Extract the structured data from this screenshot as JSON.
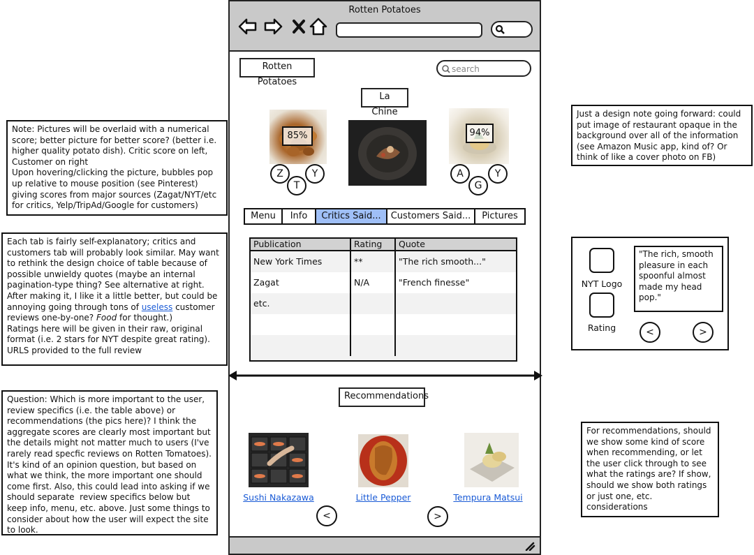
{
  "notes": {
    "left1": "Note: Pictures will be overlaid with a numerical score; better picture for better score? (better i.e. higher quality potato dish). Critic score on left, Customer on right\nUpon hovering/clicking the picture, bubbles pop up relative to mouse position (see Pinterest) giving scores from major sources (Zagat/NYT/etc for critics, Yelp/TripAd/Google for customers)",
    "left2_a": "Each tab is fairly self-explanatory; critics and customers tab will probably look similar. May want to rethink the design choice of table because of possible unwieldy quotes (maybe an internal pagination-type thing? See alternative at right. After making it, I like it a little better, but could be annoying going through tons of ",
    "left2_link": "useless",
    "left2_b": " customer reviews one-by-one? ",
    "left2_italic": "Food",
    "left2_c": " for thought.)\nRatings here will be given in their raw, original format (i.e. 2 stars for NYT despite great rating). URLS provided to the full review",
    "left3": "Question: Which is more important to the user, review specifics (i.e. the table above) or recommendations (the pics here)? I think the aggregate scores are clearly most important but the details might not matter much to users (I've rarely read specfic reviews on Rotten Tomatoes). It's kind of an opinion question, but based on what we think, the more important one should come first. Also, this could lead into asking if we should separate  review specifics below but keep info, menu, etc. above. Just some things to consider about how the user will expect the site to look.",
    "right1": "Just a design note going forward: could put image of restaurant opaque in the background over all of the information (see Amazon Music app, kind of? Or think of like a cover photo on FB)",
    "right2": "For recommendations, should we show some kind of score when recommending, or let the user click through to see what the ratings are? If show, should we show both ratings or just one, etc. considerations"
  },
  "browser": {
    "title": "Rotten Potatoes",
    "site_logo": "Rotten Potatoes",
    "search_placeholder": "search",
    "restaurant_name": "La Chine",
    "critic_score": "85%",
    "customer_score": "94%",
    "critic_bubbles": [
      "Z",
      "T",
      "Y"
    ],
    "customer_bubbles": [
      "A",
      "G",
      "Y"
    ]
  },
  "tabs": [
    "Menu",
    "Info",
    "Critics Said...",
    "Customers Said...",
    "Pictures"
  ],
  "active_tab": 2,
  "table": {
    "headers": [
      "Publication",
      "Rating",
      "Quote"
    ],
    "rows": [
      [
        "New York Times",
        "**",
        "\"The rich smooth...\""
      ],
      [
        "Zagat",
        "N/A",
        "\"French finesse\""
      ],
      [
        "etc.",
        "",
        ""
      ],
      [
        "",
        "",
        ""
      ],
      [
        "",
        "",
        ""
      ]
    ]
  },
  "alt_card": {
    "logo_label": "NYT Logo",
    "rating_label": "Rating",
    "quote": "\"The rich, smooth pleasure in each spoonful almost made my head pop.\"",
    "prev": "<",
    "next": ">"
  },
  "recommendations": {
    "title": "Recommendations",
    "items": [
      "Sushi Nakazawa",
      "Little Pepper",
      "Tempura Matsui"
    ],
    "prev": "<",
    "next": ">"
  },
  "colors": {
    "active_tab": "#9fbff7",
    "link": "#1a5bd6",
    "chrome": "#c9c9c9"
  }
}
